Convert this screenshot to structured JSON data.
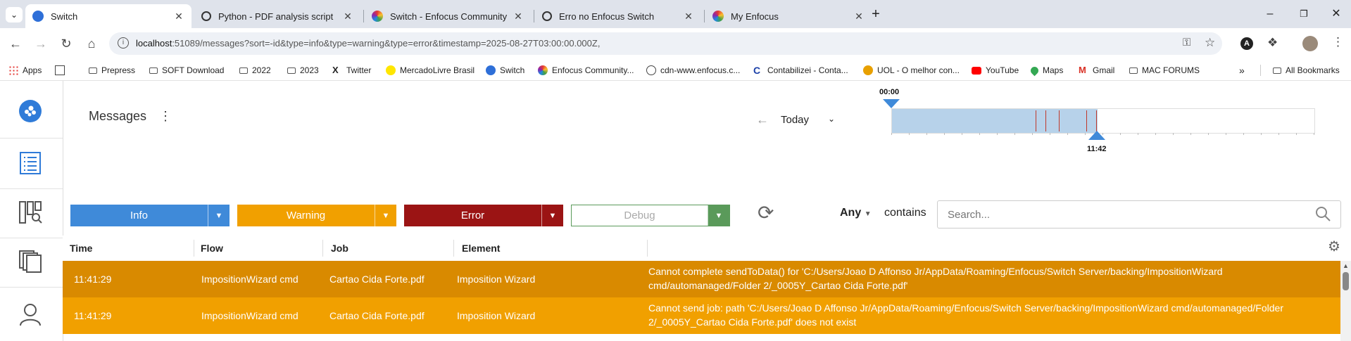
{
  "browser": {
    "tabs": [
      {
        "title": "Switch",
        "active": true,
        "favicon_color": "#2e6fd8"
      },
      {
        "title": "Python - PDF analysis script",
        "active": false,
        "favicon_color": "#333333"
      },
      {
        "title": "Switch - Enfocus Community",
        "active": false,
        "favicon_color": "#000000"
      },
      {
        "title": "Erro no Enfocus Switch",
        "active": false,
        "favicon_color": "#333333"
      },
      {
        "title": "My Enfocus",
        "active": false,
        "favicon_color": "#000000"
      }
    ],
    "url_host": "localhost",
    "url_rest": ":51089/messages?sort=-id&type=info&type=warning&type=error&timestamp=2025-08-27T03:00:00.000Z,",
    "bookmarks": [
      "Apps",
      "Prepress",
      "SOFT Download",
      "2022",
      "2023",
      "Twitter",
      "MercadoLivre Brasil",
      "Switch",
      "Enfocus Community...",
      "cdn-www.enfocus.c...",
      "Contabilizei - Conta...",
      "UOL - O melhor con...",
      "YouTube",
      "Maps",
      "Gmail",
      "MAC FORUMS"
    ],
    "all_bookmarks": "All Bookmarks"
  },
  "header": {
    "title": "Messages",
    "period": "Today",
    "timeline_start": "00:00",
    "timeline_end": "11:42",
    "timeline_fill_fraction": 0.487
  },
  "filters": {
    "info": "Info",
    "warning": "Warning",
    "error": "Error",
    "debug": "Debug",
    "match": "Any",
    "contains": "contains",
    "search_placeholder": "Search..."
  },
  "table": {
    "columns": [
      "Time",
      "Flow",
      "Job",
      "Element"
    ],
    "rows": [
      {
        "time": "11:41:29",
        "flow": "ImpositionWizard cmd",
        "job": "Cartao Cida Forte.pdf",
        "element": "Imposition Wizard",
        "message": "Cannot complete sendToData() for 'C:/Users/Joao D Affonso Jr/AppData/Roaming/Enfocus/Switch Server/backing/ImpositionWizard cmd/automanaged/Folder 2/_0005Y_Cartao Cida Forte.pdf'",
        "color": "#d98a00"
      },
      {
        "time": "11:41:29",
        "flow": "ImpositionWizard cmd",
        "job": "Cartao Cida Forte.pdf",
        "element": "Imposition Wizard",
        "message": "Cannot send job: path 'C:/Users/Joao D Affonso Jr/AppData/Roaming/Enfocus/Switch Server/backing/ImpositionWizard cmd/automanaged/Folder 2/_0005Y_Cartao Cida Forte.pdf' does not exist",
        "color": "#f1a000"
      }
    ]
  },
  "colors": {
    "info": "#3f8ad9",
    "warning": "#f1a000",
    "error": "#9b1414",
    "debug": "#5a9a5a"
  }
}
